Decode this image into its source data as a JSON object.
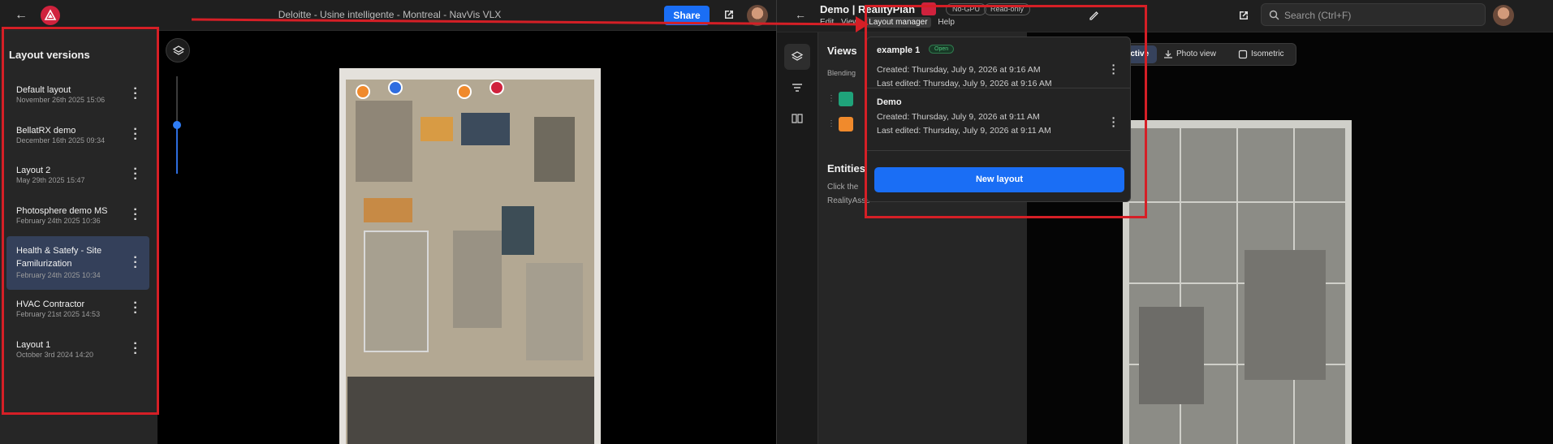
{
  "left_app": {
    "window_title": "Deloitte - Usine intelligente - Montreal - NavVis VLX",
    "share_label": "Share",
    "panel_title": "Layout versions",
    "versions": [
      {
        "name": "Default layout",
        "date": "November 26th 2025 15:06",
        "active": false
      },
      {
        "name": "BellatRX demo",
        "date": "December 16th 2025 09:34",
        "active": false
      },
      {
        "name": "Layout 2",
        "date": "May 29th 2025 15:47",
        "active": false
      },
      {
        "name": "Photosphere demo MS",
        "date": "February 24th 2025 10:36",
        "active": false
      },
      {
        "name": "Health & Satefy - Site Familurization",
        "date": "February 24th 2025 10:34",
        "active": true
      },
      {
        "name": "HVAC Contractor",
        "date": "February 21st 2025 14:53",
        "active": false
      },
      {
        "name": "Layout 1",
        "date": "October 3rd 2024 14:20",
        "active": false
      }
    ],
    "slider_level": 0.5
  },
  "right_app": {
    "project_title": "Demo | RealityPlan",
    "badges": [
      "No-GPU",
      "Read-only"
    ],
    "menu": [
      "Edit",
      "View",
      "Layout manager",
      "Help"
    ],
    "search_placeholder": "Search (Ctrl+F)",
    "views_title": "Views",
    "blending_label": "Blending",
    "entities_title": "Entities",
    "entities_text_line1": "Click the",
    "entities_text_line2": "RealityAsse",
    "modes": [
      {
        "label": "Perspective",
        "icon": "cube-icon",
        "active": true
      },
      {
        "label": "Photo view",
        "icon": "photo-view-icon",
        "active": false
      },
      {
        "label": "Isometric",
        "icon": "isometric-icon",
        "active": false
      }
    ]
  },
  "layout_manager": {
    "items": [
      {
        "name": "example 1",
        "status": "Open",
        "created": "Created: Thursday, July 9, 2026 at 9:16 AM",
        "edited": "Last edited: Thursday, July 9, 2026 at 9:16 AM"
      },
      {
        "name": "Demo",
        "status": "",
        "created": "Created: Thursday, July 9, 2026 at 9:11 AM",
        "edited": "Last edited: Thursday, July 9, 2026 at 9:11 AM"
      }
    ],
    "new_layout_label": "New layout"
  },
  "colors": {
    "accent_blue": "#1a6ef5",
    "annotation_red": "#d51f26",
    "brand_red": "#d0223d",
    "active_item_bg": "#34405a"
  }
}
